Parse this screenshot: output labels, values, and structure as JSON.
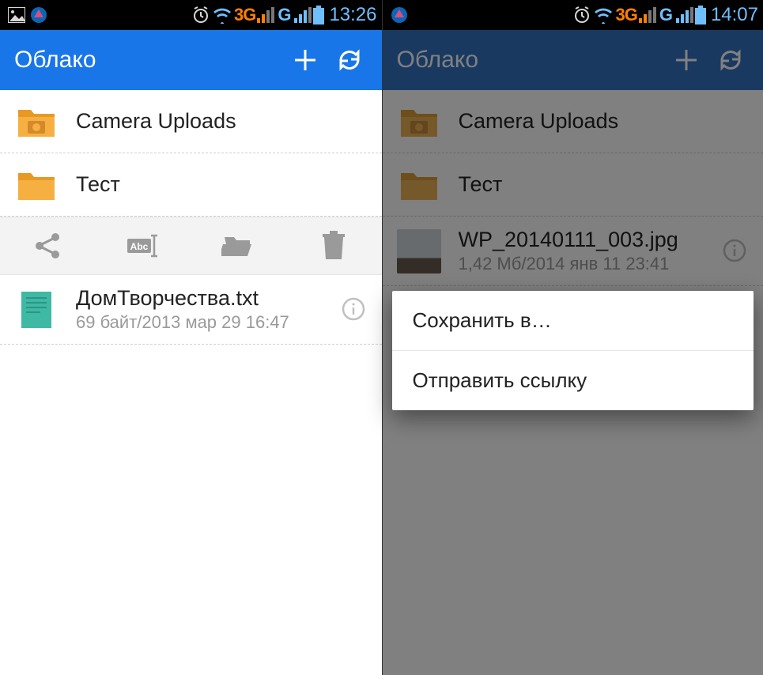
{
  "left": {
    "status": {
      "network3g": "3G",
      "networkG": "G",
      "time": "13:26"
    },
    "appbar": {
      "title": "Облако"
    },
    "rows": [
      {
        "title": "Camera Uploads"
      },
      {
        "title": "Тест"
      }
    ],
    "file": {
      "title": "ДомТворчества.txt",
      "sub": "69 байт/2013 мар 29 16:47"
    }
  },
  "right": {
    "status": {
      "network3g": "3G",
      "networkG": "G",
      "time": "14:07"
    },
    "appbar": {
      "title": "Облако"
    },
    "rows": [
      {
        "title": "Camera Uploads"
      },
      {
        "title": "Тест"
      }
    ],
    "file": {
      "title": "WP_20140111_003.jpg",
      "sub": "1,42 Мб/2014 янв 11 23:41"
    },
    "popup": {
      "save": "Сохранить в…",
      "sendlink": "Отправить ссылку"
    }
  }
}
